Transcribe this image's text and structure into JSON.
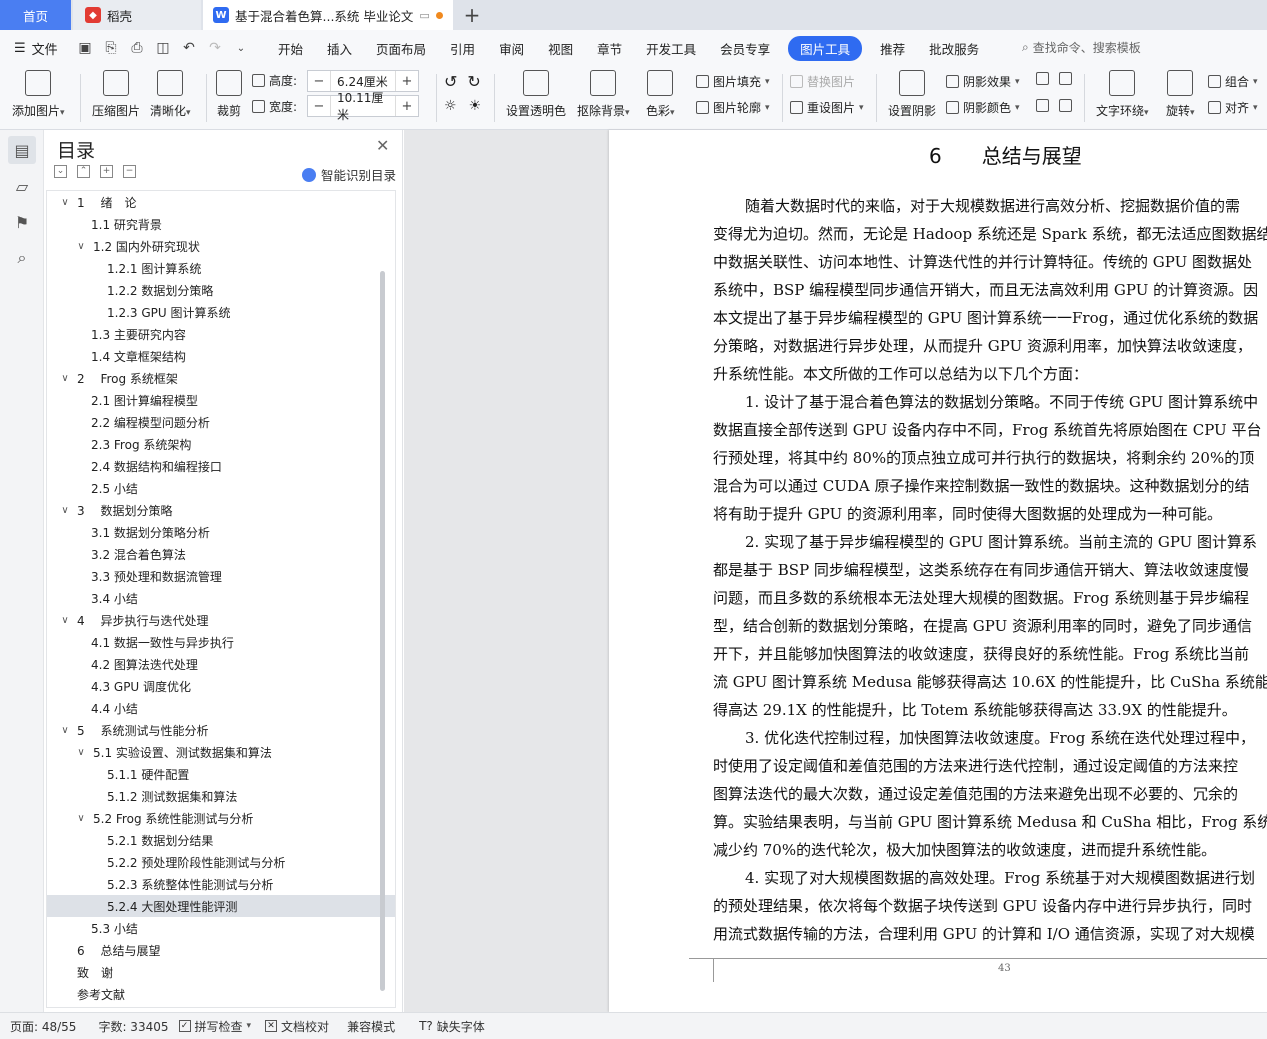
{
  "tabs": {
    "home": "首页",
    "daoke": "稻壳",
    "doc": "基于混合着色算...系统 毕业论文",
    "add": "+"
  },
  "menubar": {
    "file": "文件",
    "items": [
      "开始",
      "插入",
      "页面布局",
      "引用",
      "审阅",
      "视图",
      "章节",
      "开发工具",
      "会员专享",
      "图片工具",
      "推荐",
      "批改服务"
    ],
    "active_index": 9,
    "search": "查找命令、搜索模板"
  },
  "ribbon": {
    "add_picture": "添加图片",
    "compress": "压缩图片",
    "sharpen": "清晰化",
    "crop": "裁剪",
    "height_label": "高度:",
    "height_value": "6.24厘米",
    "width_label": "宽度:",
    "width_value": "10.11厘米",
    "set_transparent": "设置透明色",
    "remove_bg": "抠除背景",
    "color": "色彩",
    "picture_fill": "图片填充",
    "picture_outline": "图片轮廓",
    "replace_picture": "替换图片",
    "reset_picture": "重设图片",
    "set_shadow": "设置阴影",
    "shadow_effect": "阴影效果",
    "shadow_color": "阴影颜色",
    "text_wrap": "文字环绕",
    "rotate": "旋转",
    "group": "组合",
    "align": "对齐"
  },
  "toc": {
    "title": "目录",
    "smart": "智能识别目录",
    "items": [
      {
        "text": "1　 绪　论",
        "level": 1,
        "toggle": "∨"
      },
      {
        "text": "1.1 研究背景",
        "level": 2
      },
      {
        "text": "1.2 国内外研究现状",
        "level": 2,
        "toggle": "∨"
      },
      {
        "text": "1.2.1 图计算系统",
        "level": 3
      },
      {
        "text": "1.2.2 数据划分策略",
        "level": 3
      },
      {
        "text": "1.2.3 GPU 图计算系统",
        "level": 3
      },
      {
        "text": "1.3 主要研究内容",
        "level": 2
      },
      {
        "text": "1.4 文章框架结构",
        "level": 2
      },
      {
        "text": "2　 Frog 系统框架",
        "level": 1,
        "toggle": "∨"
      },
      {
        "text": "2.1 图计算编程模型",
        "level": 2
      },
      {
        "text": "2.2 编程模型问题分析",
        "level": 2
      },
      {
        "text": "2.3 Frog 系统架构",
        "level": 2
      },
      {
        "text": "2.4 数据结构和编程接口",
        "level": 2
      },
      {
        "text": "2.5 小结",
        "level": 2
      },
      {
        "text": "3　 数据划分策略",
        "level": 1,
        "toggle": "∨"
      },
      {
        "text": "3.1 数据划分策略分析",
        "level": 2
      },
      {
        "text": "3.2 混合着色算法",
        "level": 2
      },
      {
        "text": "3.3 预处理和数据流管理",
        "level": 2
      },
      {
        "text": "3.4 小结",
        "level": 2
      },
      {
        "text": "4　 异步执行与迭代处理",
        "level": 1,
        "toggle": "∨"
      },
      {
        "text": "4.1 数据一致性与异步执行",
        "level": 2
      },
      {
        "text": "4.2 图算法迭代处理",
        "level": 2
      },
      {
        "text": "4.3 GPU 调度优化",
        "level": 2
      },
      {
        "text": "4.4 小结",
        "level": 2
      },
      {
        "text": "5　 系统测试与性能分析",
        "level": 1,
        "toggle": "∨"
      },
      {
        "text": "5.1 实验设置、测试数据集和算法",
        "level": 2,
        "toggle": "∨"
      },
      {
        "text": "5.1.1 硬件配置",
        "level": 3
      },
      {
        "text": "5.1.2 测试数据集和算法",
        "level": 3
      },
      {
        "text": "5.2 Frog 系统性能测试与分析",
        "level": 2,
        "toggle": "∨"
      },
      {
        "text": "5.2.1 数据划分结果",
        "level": 3
      },
      {
        "text": "5.2.2 预处理阶段性能测试与分析",
        "level": 3
      },
      {
        "text": "5.2.3 系统整体性能测试与分析",
        "level": 3
      },
      {
        "text": "5.2.4 大图处理性能评测",
        "level": 3,
        "selected": true
      },
      {
        "text": "5.3 小结",
        "level": 2
      },
      {
        "text": "6　 总结与展望",
        "level": 1
      },
      {
        "text": "致　谢",
        "level": 1
      },
      {
        "text": "参考文献",
        "level": 1
      }
    ]
  },
  "page": {
    "title": "6　　总结与展望",
    "lines": [
      {
        "text": "随着大数据时代的来临，对于大规模数据进行高效分析、挖掘数据价值的需",
        "indent": true
      },
      {
        "text": "变得尤为迫切。然而，无论是 Hadoop 系统还是 Spark 系统，都无法适应图数据结",
        "indent": false
      },
      {
        "text": "中数据关联性、访问本地性、计算迭代性的并行计算特征。传统的 GPU 图数据处",
        "indent": false
      },
      {
        "text": "系统中，BSP 编程模型同步通信开销大，而且无法高效利用 GPU 的计算资源。因",
        "indent": false
      },
      {
        "text": "本文提出了基于异步编程模型的 GPU 图计算系统一一Frog，通过优化系统的数据",
        "indent": false
      },
      {
        "text": "分策略，对数据进行异步处理，从而提升 GPU 资源利用率，加快算法收敛速度，",
        "indent": false
      },
      {
        "text": "升系统性能。本文所做的工作可以总结为以下几个方面：",
        "indent": false
      },
      {
        "text": "1. 设计了基于混合着色算法的数据划分策略。不同于传统 GPU 图计算系统中",
        "indent": true
      },
      {
        "text": "数据直接全部传送到 GPU 设备内存中不同，Frog 系统首先将原始图在 CPU 平台",
        "indent": false
      },
      {
        "text": "行预处理，将其中约 80%的顶点独立成可并行执行的数据块，将剩余约 20%的顶",
        "indent": false
      },
      {
        "text": "混合为可以通过 CUDA 原子操作来控制数据一致性的数据块。这种数据划分的结",
        "indent": false
      },
      {
        "text": "将有助于提升 GPU 的资源利用率，同时使得大图数据的处理成为一种可能。",
        "indent": false
      },
      {
        "text": "2. 实现了基于异步编程模型的 GPU 图计算系统。当前主流的 GPU 图计算系",
        "indent": true
      },
      {
        "text": "都是基于 BSP 同步编程模型，这类系统存在有同步通信开销大、算法收敛速度慢",
        "indent": false
      },
      {
        "text": "问题，而且多数的系统根本无法处理大规模的图数据。Frog 系统则基于异步编程",
        "indent": false
      },
      {
        "text": "型，结合创新的数据划分策略，在提高 GPU 资源利用率的同时，避免了同步通信",
        "indent": false
      },
      {
        "text": "开下，并且能够加快图算法的收敛速度，获得良好的系统性能。Frog 系统比当前",
        "indent": false
      },
      {
        "text": "流 GPU 图计算系统 Medusa 能够获得高达 10.6X 的性能提升，比 CuSha 系统能够",
        "indent": false
      },
      {
        "text": "得高达 29.1X 的性能提升，比 Totem 系统能够获得高达 33.9X 的性能提升。",
        "indent": false
      },
      {
        "text": "3. 优化迭代控制过程，加快图算法收敛速度。Frog 系统在迭代处理过程中，",
        "indent": true
      },
      {
        "text": "时使用了设定阈值和差值范围的方法来进行迭代控制，通过设定阈值的方法来控",
        "indent": false
      },
      {
        "text": "图算法迭代的最大次数，通过设定差值范围的方法来避免出现不必要的、冗余的",
        "indent": false
      },
      {
        "text": "算。实验结果表明，与当前 GPU 图计算系统 Medusa 和 CuSha 相比，Frog 系统可",
        "indent": false
      },
      {
        "text": "减少约 70%的迭代轮次，极大加快图算法的收敛速度，进而提升系统性能。",
        "indent": false
      },
      {
        "text": "4. 实现了对大规模图数据的高效处理。Frog 系统基于对大规模图数据进行划",
        "indent": true
      },
      {
        "text": "的预处理结果，依次将每个数据子块传送到 GPU 设备内存中进行异步执行，同时",
        "indent": false
      },
      {
        "text": "用流式数据传输的方法，合理利用 GPU 的计算和 I/O 通信资源，实现了对大规模",
        "indent": false
      }
    ],
    "page_number": "43"
  },
  "status": {
    "page": "页面: 48/55",
    "words": "字数: 33405",
    "spell": "拼写检查",
    "proof": "文档校对",
    "compat": "兼容模式",
    "missing_font": "缺失字体"
  }
}
